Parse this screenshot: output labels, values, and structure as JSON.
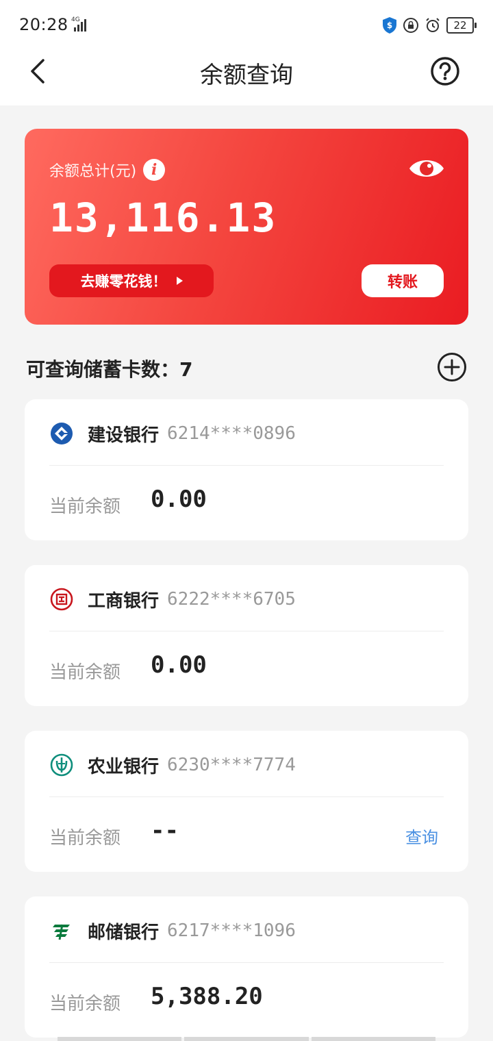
{
  "status_bar": {
    "time": "20:28",
    "network": "4G",
    "battery": "22"
  },
  "header": {
    "title": "余额查询"
  },
  "balance_card": {
    "label": "余额总计(元)",
    "amount": "13,116.13",
    "earn_button": "去赚零花钱！",
    "transfer_button": "转账",
    "accent_color": "#e3181e"
  },
  "section": {
    "title": "可查询储蓄卡数：7"
  },
  "cards": [
    {
      "bank_name": "建设银行",
      "card_number": "6214****0896",
      "balance_label": "当前余额",
      "balance": "0.00",
      "logo": "ccb-logo-icon",
      "logo_color": "#1d5bb0"
    },
    {
      "bank_name": "工商银行",
      "card_number": "6222****6705",
      "balance_label": "当前余额",
      "balance": "0.00",
      "logo": "icbc-logo-icon",
      "logo_color": "#c8161d"
    },
    {
      "bank_name": "农业银行",
      "card_number": "6230****7774",
      "balance_label": "当前余额",
      "balance": "--",
      "query_label": "查询",
      "logo": "abc-logo-icon",
      "logo_color": "#0f8e7c"
    },
    {
      "bank_name": "邮储银行",
      "card_number": "6217****1096",
      "balance_label": "当前余额",
      "balance": "5,388.20",
      "logo": "psbc-logo-icon",
      "logo_color": "#0a7a3d"
    }
  ]
}
